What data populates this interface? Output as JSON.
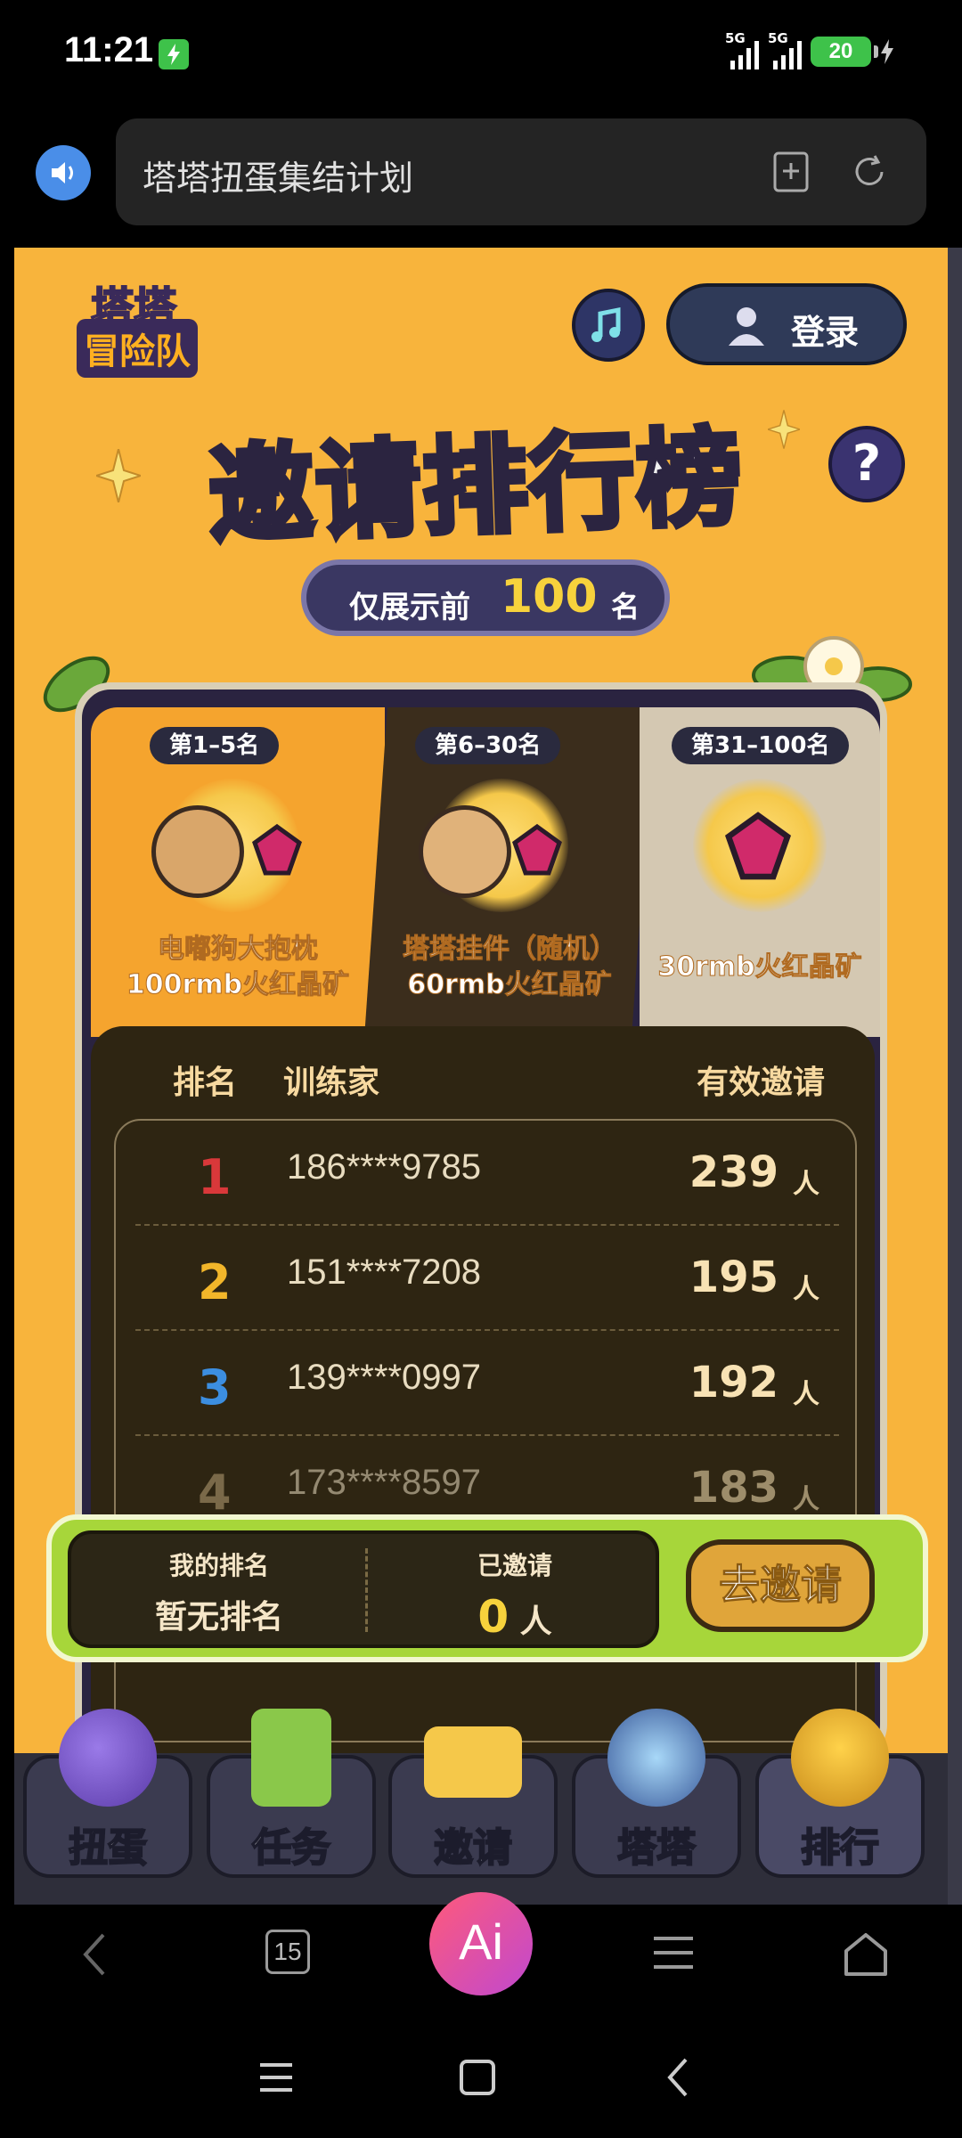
{
  "status_bar": {
    "time": "11:21",
    "signal1_label": "5G",
    "signal2_label": "5G",
    "battery": "20"
  },
  "browser": {
    "url_title": "塔塔扭蛋集结计划",
    "tabs_count": "15",
    "ai_label": "Ai"
  },
  "header": {
    "logo_line1": "塔塔",
    "logo_line2": "冒险队",
    "login_label": "登录",
    "help_label": "?"
  },
  "hero": {
    "title_part1": "邀请",
    "title_part2": "排行榜",
    "badge_prefix": "仅展示前",
    "badge_number": "100",
    "badge_suffix": "名"
  },
  "tiers": [
    {
      "label": "第1–5名",
      "reward_line1": "电嘟狗大抱枕",
      "reward_line2": "100rmb火红晶矿"
    },
    {
      "label": "第6–30名",
      "reward_line1": "塔塔挂件（随机）",
      "reward_line2": "60rmb火红晶矿"
    },
    {
      "label": "第31–100名",
      "reward_line1": "30rmb火红晶矿",
      "reward_line2": ""
    }
  ],
  "ranking": {
    "headers": {
      "rank": "排名",
      "trainer": "训练家",
      "invites": "有效邀请"
    },
    "unit": "人",
    "rows": [
      {
        "rank": "1",
        "phone": "186****9785",
        "count": "239",
        "color": "#d9383a"
      },
      {
        "rank": "2",
        "phone": "151****7208",
        "count": "195",
        "color": "#f2b62a"
      },
      {
        "rank": "3",
        "phone": "139****0997",
        "count": "192",
        "color": "#3c8ee0"
      },
      {
        "rank": "4",
        "phone": "173****8597",
        "count": "183",
        "color": "#b8a276"
      }
    ]
  },
  "my_rank": {
    "rank_label": "我的排名",
    "rank_value": "暂无排名",
    "invited_label": "已邀请",
    "invited_count": "0",
    "invited_unit": "人",
    "invite_button": "去邀请"
  },
  "web_nav": [
    {
      "label": "扭蛋",
      "icon": "capsule-icon"
    },
    {
      "label": "任务",
      "icon": "clipboard-icon"
    },
    {
      "label": "邀请",
      "icon": "envelope-icon"
    },
    {
      "label": "塔塔",
      "icon": "cat-icon"
    },
    {
      "label": "排行",
      "icon": "trophy-icon"
    }
  ],
  "colors": {
    "page_bg": "#f8b43c",
    "accent_gold": "#f7d23c",
    "board_dark": "#2e2512",
    "my_bar_green": "#a7d63a"
  }
}
